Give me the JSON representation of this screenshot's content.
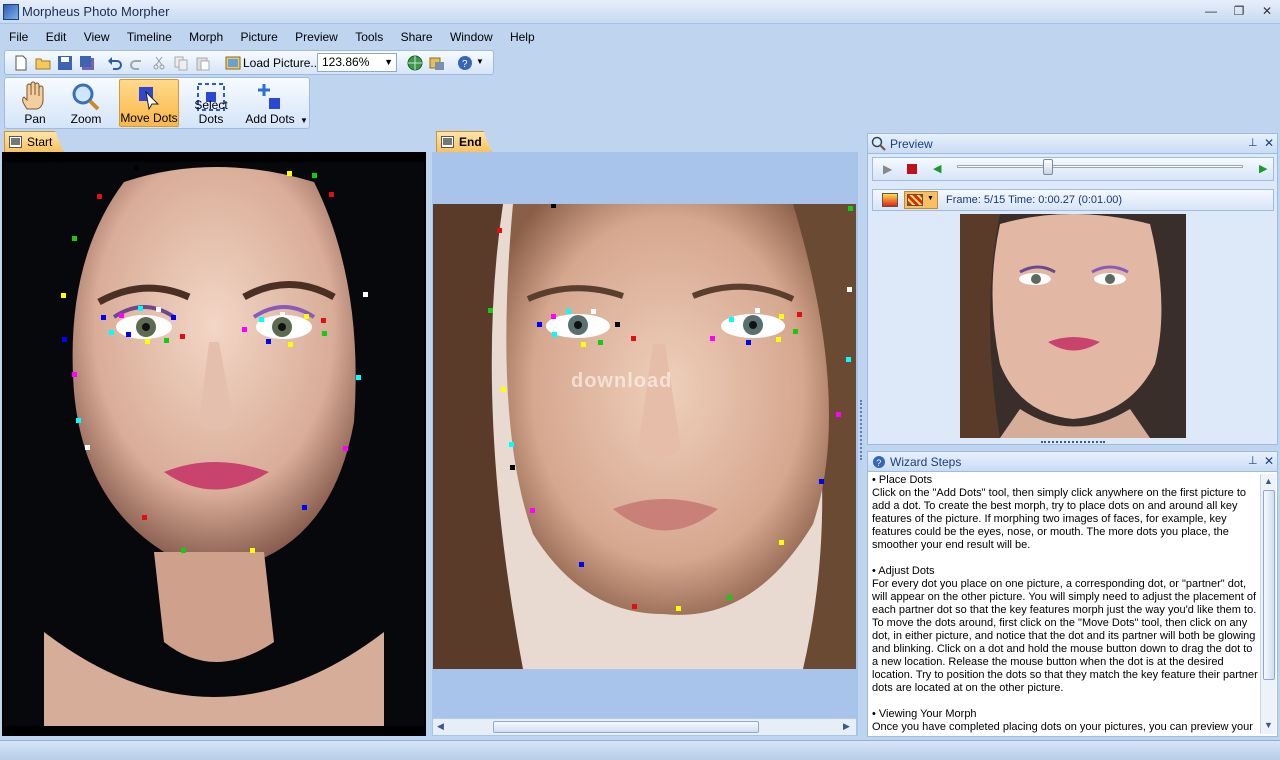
{
  "window": {
    "title": "Morpheus Photo Morpher"
  },
  "menu": [
    "File",
    "Edit",
    "View",
    "Timeline",
    "Morph",
    "Picture",
    "Preview",
    "Tools",
    "Share",
    "Window",
    "Help"
  ],
  "toolbar": {
    "load_label": "Load Picture...",
    "zoom_value": "123.86%"
  },
  "tools": [
    {
      "label": "Pan",
      "icon": "hand-icon"
    },
    {
      "label": "Zoom",
      "icon": "magnifier-icon"
    },
    {
      "label": "Move Dots",
      "icon": "move-dots-icon",
      "active": true
    },
    {
      "label": "Select Dots",
      "icon": "select-dots-icon"
    },
    {
      "label": "Add Dots",
      "icon": "add-dots-icon"
    }
  ],
  "panes": {
    "start_label": "Start",
    "end_label": "End"
  },
  "preview": {
    "title": "Preview",
    "frame_info": "Frame: 5/15 Time: 0:00.27 (0:01.00)",
    "progress": 0.31
  },
  "wizard": {
    "title": "Wizard Steps",
    "sections": [
      {
        "heading": "• Place Dots",
        "body": "Click on the \"Add Dots\" tool, then simply click anywhere on the first picture to add a dot.  To create the best morph, try to place dots on and around all key features of the picture.  If morphing two images of faces, for example, key features could be the eyes, nose, or mouth.  The more dots you place, the smoother your end result will be."
      },
      {
        "heading": "• Adjust Dots",
        "body": "For every dot you place on one picture, a corresponding dot, or \"partner\" dot, will appear on the other picture.  You will simply need to adjust the placement of each partner dot so that the key features morph just the way you'd like them to.  To move the dots around, first click on the \"Move Dots\" tool, then click on any dot, in either picture, and notice that the dot and its partner will both be glowing and blinking.  Click on a dot and hold the mouse button down to drag the dot to a new location.  Release the mouse button when the dot is at the desired location.  Try to position the dots so that they match the key feature their partner dots are located at on the other picture."
      },
      {
        "heading": "• Viewing Your Morph",
        "body": "Once you have completed placing dots on your pictures, you can preview your"
      }
    ]
  },
  "watermark": "download"
}
